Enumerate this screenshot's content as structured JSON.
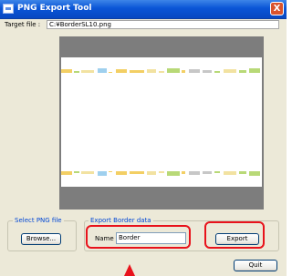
{
  "window": {
    "title": "PNG Export Tool",
    "close_glyph": "X"
  },
  "target": {
    "label": "Target file :",
    "value": "C:¥BorderSL10.png"
  },
  "select_group": {
    "label": "Select PNG file",
    "browse_label": "Browse..."
  },
  "export_group": {
    "label": "Export Border data",
    "name_label": "Name",
    "name_value": "Border",
    "export_label": "Export"
  },
  "quit_label": "Quit",
  "annotation_color": "#e8121b",
  "strip_colors": [
    "#f3cf64",
    "#9fd0ee",
    "#b8d977",
    "#c7c7c7",
    "#f2e2a1"
  ]
}
